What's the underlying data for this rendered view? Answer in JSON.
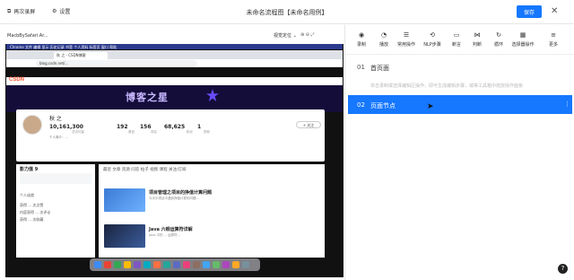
{
  "topbar": {
    "rerecord": "再次录屏",
    "settings": "设置",
    "title": "未命名流程图【未命名用例】",
    "save": "保存"
  },
  "left": {
    "preview_label": "MacbBySafari Ar...",
    "view_dropdown": "视觉定位 ⌄",
    "shot": {
      "tab_label": "秋 之 - CSDN博客",
      "url": "blog.csdn.net/...",
      "logo": "CSDN",
      "banner": "博客之星",
      "name": "秋 之",
      "stats": [
        {
          "value": "10,161,300",
          "label": "总访问量"
        },
        {
          "value": "192",
          "label": "原创"
        },
        {
          "value": "156",
          "label": "排名"
        },
        {
          "value": "68,625",
          "label": "粉丝"
        },
        {
          "value": "1",
          "label": "铁粉"
        }
      ],
      "follow": "+ 关注",
      "side_title": "影力值 9",
      "side_lines": [
        "个人成就",
        "获得 ... 次点赞",
        "内容获得 ... 次评论",
        "获得 ... 次收藏"
      ],
      "tabs": "最近  文章  资源  问答  帖子  视频  课程  关注/订阅",
      "articles": [
        {
          "title": "项目管理之项目的挣值计算问题",
          "desc": "今天中项目中遇到挣值计算的问题..."
        },
        {
          "title": "Java 六眼运算符详解",
          "desc": "Java 中的 ... 运算符..."
        }
      ]
    }
  },
  "toolbar": [
    {
      "icon": "record-icon",
      "glyph": "◉",
      "label": "录制"
    },
    {
      "icon": "wait-icon",
      "glyph": "◔",
      "label": "播放"
    },
    {
      "icon": "common-icon",
      "glyph": "☰",
      "label": "常用操作"
    },
    {
      "icon": "nlp-icon",
      "glyph": "⟲",
      "label": "NLP步骤"
    },
    {
      "icon": "assert-icon",
      "glyph": "▭",
      "label": "断言"
    },
    {
      "icon": "condition-icon",
      "glyph": "⋈",
      "label": "判断"
    },
    {
      "icon": "loop-icon",
      "glyph": "↻",
      "label": "循环"
    },
    {
      "icon": "selector-icon",
      "glyph": "▦",
      "label": "选择器操作"
    },
    {
      "icon": "more-icon",
      "glyph": "≡",
      "label": "更多"
    }
  ],
  "steps": [
    {
      "num": "01",
      "title": "首页面",
      "sub": "单击录制或选择编辑区操作，即可生成编辑步骤，或等工具箱中拖放操作面板"
    },
    {
      "num": "02",
      "title": "页面节点"
    }
  ],
  "help": "?"
}
